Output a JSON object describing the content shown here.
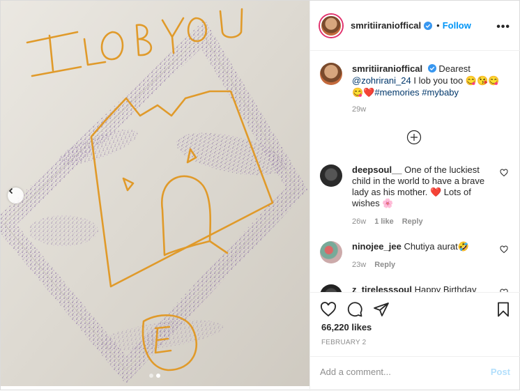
{
  "post": {
    "username": "smritiiranioffical",
    "follow_separator": "•",
    "follow_label": "Follow",
    "more_label": "•••"
  },
  "image": {
    "drawn_text": "ILOBYOU",
    "drawn_letter": "E",
    "page_count": 2,
    "active_page": 2
  },
  "caption": {
    "username": "smritiiranioffical",
    "text_lead": "Dearest ",
    "mention": "@zohrirani_24",
    "text_mid": " I lob you too ",
    "emojis_a": "😋😘😋",
    "emojis_b": "😋❤️",
    "hashtags": "#memories #mybaby",
    "time": "29w"
  },
  "comments": [
    {
      "username": "deepsoul__",
      "text": "One of the luckiest child in the world to have a brave lady as his mother. ❤️ Lots of wishes 🌸",
      "time": "26w",
      "likes": "1 like",
      "reply": "Reply"
    },
    {
      "username": "ninojee_jee",
      "text": "Chutiya aurat🤣",
      "time": "23w",
      "reply": "Reply"
    },
    {
      "username": "z_tirelesssoul",
      "text": "Happy Birthday"
    }
  ],
  "actions": {
    "likes": "66,220 likes",
    "date": "FEBRUARY 2"
  },
  "add_comment": {
    "placeholder": "Add a comment...",
    "post_label": "Post"
  },
  "colors": {
    "accent": "#0095f6",
    "link": "#00376b",
    "muted": "#8e8e8e",
    "heart": "#ed4956",
    "crayon": "#e09a2a",
    "glitter": "#8a6fa3"
  }
}
